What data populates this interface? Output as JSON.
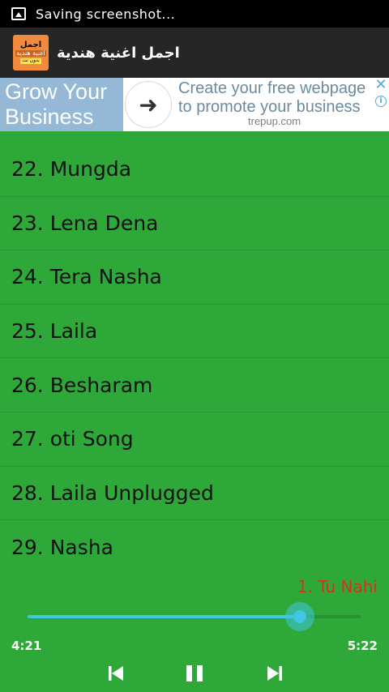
{
  "status_bar": {
    "text": "Saving screenshot..."
  },
  "app": {
    "title": "اجمل اغنية هندية",
    "icon_line1": "اجمل",
    "icon_line2": "اغنية هندية",
    "icon_line3": "بدون نت"
  },
  "ad": {
    "left_text": "Grow Your Business",
    "text": "Create your free webpage to promote your business",
    "domain": "trepup.com",
    "close_icon": "close-icon",
    "info_icon": "info-icon"
  },
  "songs": [
    "22. Mungda",
    "23. Lena Dena",
    "24. Tera Nasha",
    "25. Laila",
    "26. Besharam",
    "27. oti Song",
    "28. Laila Unplugged",
    "29. Nasha"
  ],
  "player": {
    "now_playing": "1. Tu Nahi",
    "current_time": "4:21",
    "total_time": "5:22",
    "progress": 0.815
  },
  "colors": {
    "background": "#2fa83a",
    "accent": "#3ec6e2",
    "now_playing": "#d6331a"
  }
}
